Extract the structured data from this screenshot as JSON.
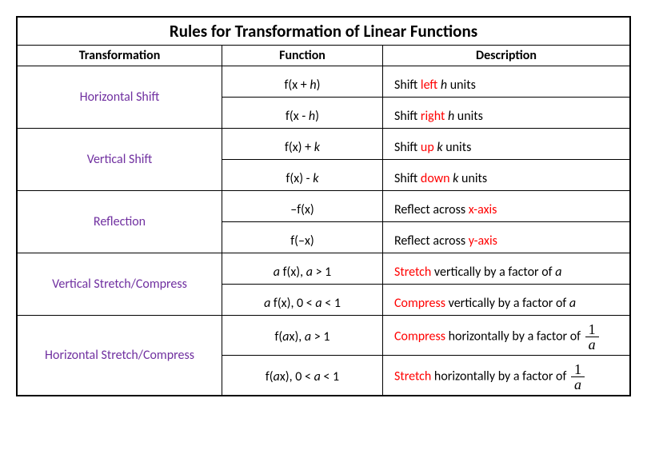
{
  "title": "Rules for Transformation of Linear Functions",
  "headers": {
    "col1": "Transformation",
    "col2": "Function",
    "col3": "Description"
  },
  "rows": [
    {
      "transformation": "Horizontal Shift",
      "sub": [
        {
          "func_pre": "f(x + ",
          "func_it": "h",
          "func_post": ")",
          "desc_pre": "Shift ",
          "desc_red": "left",
          "desc_post_pre_it": " ",
          "desc_it": "h",
          "desc_post": " units"
        },
        {
          "func_pre": "f(x  - ",
          "func_it": "h",
          "func_post": ")",
          "desc_pre": "Shift ",
          "desc_red": "right",
          "desc_post_pre_it": " ",
          "desc_it": "h",
          "desc_post": " units"
        }
      ]
    },
    {
      "transformation": "Vertical Shift",
      "sub": [
        {
          "func_pre": "f(x) + ",
          "func_it": "k",
          "func_post": "",
          "desc_pre": "Shift ",
          "desc_red": "up",
          "desc_post_pre_it": " ",
          "desc_it": "k",
          "desc_post": " units"
        },
        {
          "func_pre": "f(x) - ",
          "func_it": "k",
          "func_post": "",
          "desc_pre": "Shift ",
          "desc_red": "down",
          "desc_post_pre_it": " ",
          "desc_it": "k",
          "desc_post": " units"
        }
      ]
    },
    {
      "transformation": "Reflection",
      "sub": [
        {
          "func_pre": "–f(x)",
          "func_it": "",
          "func_post": "",
          "desc_pre": "Reflect across ",
          "desc_red": "x-axis",
          "desc_post_pre_it": "",
          "desc_it": "",
          "desc_post": ""
        },
        {
          "func_pre": "f(–x)",
          "func_it": "",
          "func_post": "",
          "desc_pre": "Reflect across ",
          "desc_red": "y-axis",
          "desc_post_pre_it": "",
          "desc_it": "",
          "desc_post": ""
        }
      ]
    },
    {
      "transformation": "Vertical Stretch/Compress",
      "sub": [
        {
          "func_it_pre": "a",
          "func_mid": " f(x), ",
          "func_it_mid": "a",
          "func_post": " > 1",
          "desc_red": "Stretch",
          "desc_mid": " vertically by a factor of ",
          "desc_it": "a"
        },
        {
          "func_it_pre": "a",
          "func_mid": " f(x), 0 < ",
          "func_it_mid": "a",
          "func_post": " < 1",
          "desc_red": "Compress",
          "desc_mid": " vertically by a factor of ",
          "desc_it": "a"
        }
      ]
    },
    {
      "transformation": "Horizontal Stretch/Compress",
      "sub": [
        {
          "func_pre": "f(",
          "func_it_pre": "a",
          "func_mid": "x), ",
          "func_it_mid": "a",
          "func_post": " > 1",
          "desc_red": "Compress",
          "desc_mid": " horizontally by a factor of ",
          "frac_num": "1",
          "frac_den": "a"
        },
        {
          "func_pre": "f(",
          "func_it_pre": "a",
          "func_mid": "x), 0 < ",
          "func_it_mid": "a",
          "func_post": " < 1",
          "desc_red": "Stretch",
          "desc_mid": " horizontally by a factor of ",
          "frac_num": "1",
          "frac_den": "a"
        }
      ]
    }
  ]
}
